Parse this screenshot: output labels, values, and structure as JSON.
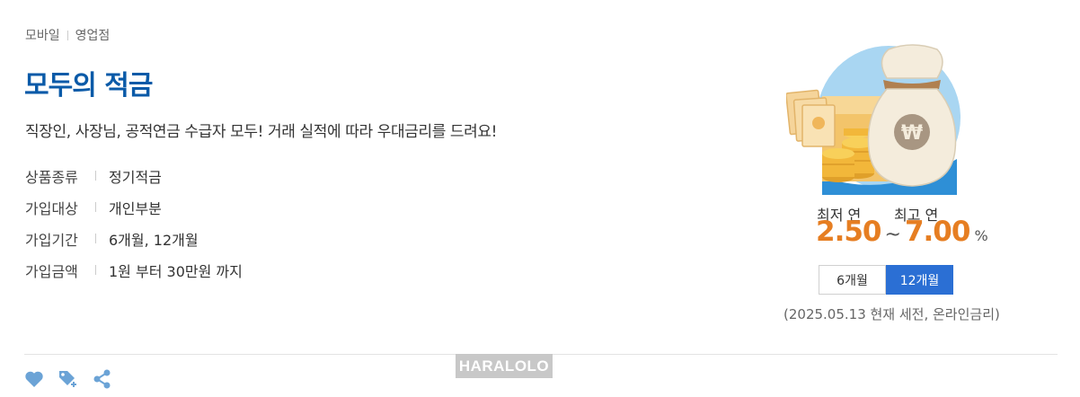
{
  "channels": [
    "모바일",
    "영업점"
  ],
  "product": {
    "title": "모두의 적금",
    "description": "직장인, 사장님, 공적연금 수급자 모두! 거래 실적에 따라 우대금리를 드려요!"
  },
  "specs": [
    {
      "label": "상품종류",
      "value": "정기적금"
    },
    {
      "label": "가입대상",
      "value": "개인부분"
    },
    {
      "label": "가입기간",
      "value": "6개월, 12개월"
    },
    {
      "label": "가입금액",
      "value": "1원 부터 30만원 까지"
    }
  ],
  "rates": {
    "min_label": "최저 연",
    "max_label": "최고 연",
    "min": "2.50",
    "tilde": "~",
    "max": "7.00",
    "unit": "%"
  },
  "tabs": [
    {
      "label": "6개월",
      "active": false
    },
    {
      "label": "12개월",
      "active": true
    }
  ],
  "rate_note": "(2025.05.13 현재 세전, 온라인금리)",
  "watermark": "HARALOLO",
  "icons": {
    "like": "heart-icon",
    "tag": "tag-plus-icon",
    "share": "share-icon",
    "illustration": "money-bag-coins-illustration"
  },
  "colors": {
    "title": "#0a5aa8",
    "rate": "#e67e22",
    "active_tab": "#2b6fd4",
    "icon": "#6ba3d6"
  }
}
